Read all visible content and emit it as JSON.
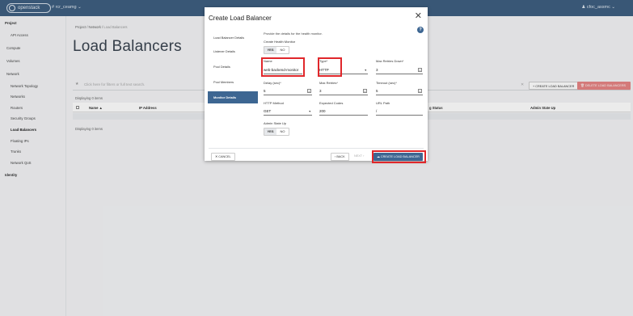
{
  "header": {
    "logo_text": "openstack",
    "project_label": "# rcr_ceamg ⌄",
    "user_label": "♟ cfoc_assmc ⌄"
  },
  "sidebar": {
    "items": [
      {
        "label": "Project",
        "heading": true
      },
      {
        "label": "API Access"
      },
      {
        "label": "Compute",
        "heading": true
      },
      {
        "label": "Volumes",
        "heading": true
      },
      {
        "label": "Network",
        "heading": true
      },
      {
        "label": "Network Topology"
      },
      {
        "label": "Networks"
      },
      {
        "label": "Routers"
      },
      {
        "label": "Security Groups"
      },
      {
        "label": "Load Balancers",
        "active": true
      },
      {
        "label": "Floating IPs"
      },
      {
        "label": "Trunks"
      },
      {
        "label": "Network QoS"
      },
      {
        "label": "Identity",
        "heading": true
      }
    ]
  },
  "main": {
    "breadcrumb_a": "Project",
    "breadcrumb_b": "Network",
    "breadcrumb_c": "Load Balancers",
    "title": "Load Balancers",
    "filter_placeholder": "Click here for filters or full text search.",
    "create_button": "+ CREATE LOAD BALANCER",
    "delete_button": "🗑 DELETE LOAD BALANCERS",
    "displaying_top": "Displaying 0 items",
    "displaying_bottom": "Displaying 0 items",
    "columns": [
      "Name ▲",
      "IP Address",
      "g Status",
      "Admin State Up"
    ]
  },
  "modal": {
    "title": "Create Load Balancer",
    "nav": [
      {
        "label": "Load Balancer Details"
      },
      {
        "label": "Listener Details"
      },
      {
        "label": "Pool Details"
      },
      {
        "label": "Pool Members"
      },
      {
        "label": "Monitor Details",
        "active": true
      }
    ],
    "description": "Provide the details for the health monitor.",
    "create_health_monitor_label": "Create Health Monitor",
    "yes": "YES",
    "no": "NO",
    "name_label": "Name",
    "name_value": "web-backend-monitor",
    "type_label": "Type",
    "type_value": "HTTP",
    "max_retries_down_label": "Max Retries Down",
    "max_retries_down_value": "3",
    "delay_label": "Delay (sec)",
    "delay_value": "5",
    "max_retries_label": "Max Retries",
    "max_retries_value": "3",
    "timeout_label": "Timeout (sec)",
    "timeout_value": "5",
    "http_method_label": "HTTP Method",
    "http_method_value": "GET",
    "expected_codes_label": "Expected Codes",
    "expected_codes_value": "200",
    "url_path_label": "URL Path",
    "url_path_value": "/",
    "admin_state_up_label": "Admin State Up",
    "cancel": "✕ CANCEL",
    "back": "‹ BACK",
    "next": "NEXT ›",
    "create": "☁ CREATE LOAD BALANCER"
  },
  "colors": {
    "topbar": "#3e5f80",
    "accent": "#3d6692",
    "highlight": "#e0272b",
    "delete": "#e78585"
  }
}
